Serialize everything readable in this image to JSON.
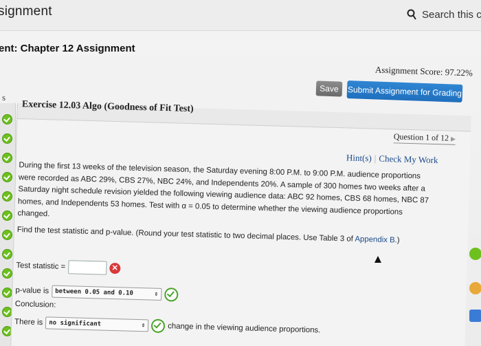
{
  "topbar": {
    "title": "signment",
    "search_text": "Search this co"
  },
  "assignment_title": "ent: Chapter 12 Assignment",
  "score_text": "Assignment Score: 97.22%",
  "buttons": {
    "save": "Save",
    "submit": "Submit Assignment for Grading"
  },
  "sidebar": {
    "s_label": "s"
  },
  "exercise": {
    "title": "Exercise 12.03 Algo (Goodness of Fit Test)",
    "question_nav": "Question 1 of 12",
    "hints": "Hint(s)",
    "check_work": "Check My Work",
    "paragraph1": "During the first 13 weeks of the television season, the Saturday evening 8:00 P.M. to 9:00 P.M. audience proportions were recorded as ABC 29%, CBS 27%, NBC 24%, and Independents 20%. A sample of 300 homes two weeks after a Saturday night schedule revision yielded the following viewing audience data: ABC 92 homes, CBS 68 homes, NBC 87 homes, and Independents 53 homes. Test with α = 0.05 to determine whether the viewing audience proportions changed.",
    "paragraph2": "Find the test statistic and p-value. (Round your test statistic to two decimal places. Use Table 3 of ",
    "appendix_link": "Appendix B.",
    "paragraph2_end": ")",
    "test_stat_label": "Test statistic =",
    "test_stat_value": "",
    "pvalue_label": "p-value is",
    "pvalue_selected": "between 0.05 and 0.10",
    "conclusion_label": "Conclusion:",
    "there_is_label": "There is",
    "significance_selected": "no significant",
    "change_text": "change in the viewing audience proportions."
  },
  "colors": {
    "submit": "#1f6fbd",
    "save": "#7a7a7a",
    "correct": "#4aa32a",
    "wrong": "#d8393a",
    "strip_dot": "#6dc01e"
  }
}
